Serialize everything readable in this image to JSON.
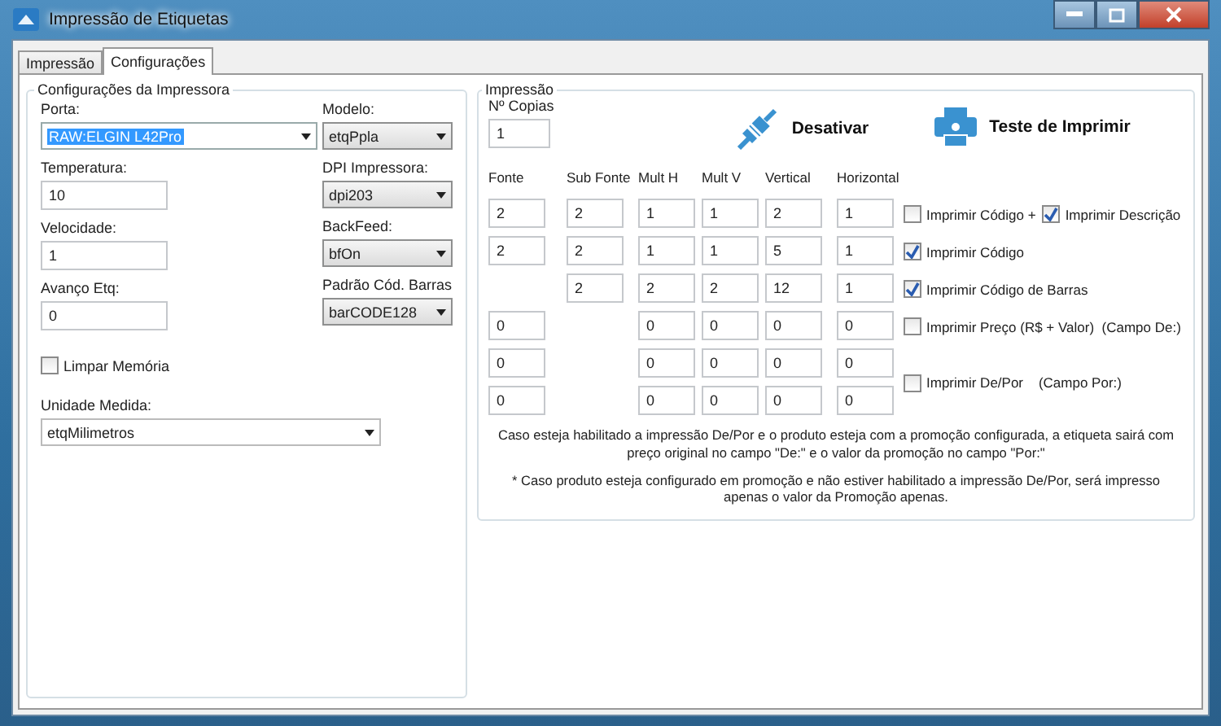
{
  "window": {
    "title": "Impressão de Etiquetas"
  },
  "tabs": [
    {
      "label": "Impressão",
      "selected": false
    },
    {
      "label": "Configurações",
      "selected": true
    }
  ],
  "printer_config": {
    "title": "Configurações da Impressora",
    "left_fields": [
      {
        "label": "Porta:",
        "kind": "combo",
        "value": "RAW:ELGIN L42Pro",
        "focused": true
      },
      {
        "label": "Temperatura:",
        "kind": "text",
        "value": "10"
      },
      {
        "label": "Velocidade:",
        "kind": "text",
        "value": "1"
      },
      {
        "label": "Avanço Etq:",
        "kind": "text",
        "value": "0"
      }
    ],
    "right_fields": [
      {
        "label": "Modelo:",
        "value": "etqPpla"
      },
      {
        "label": "DPI Impressora:",
        "value": "dpi203"
      },
      {
        "label": "BackFeed:",
        "value": "bfOn"
      },
      {
        "label": "Padrão Cód. Barras",
        "value": "barCODE128"
      }
    ],
    "clear_memory": {
      "label": "Limpar Memória",
      "checked": false
    },
    "unit": {
      "label": "Unidade Medida:",
      "value": "etqMilimetros"
    }
  },
  "printing": {
    "title": "Impressão",
    "copies": {
      "label": "Nº Copias",
      "value": "1"
    },
    "buttons": [
      {
        "label": "Desativar",
        "kind": "plug"
      },
      {
        "label": "Teste de Imprimir",
        "kind": "printer"
      }
    ],
    "columns": [
      "Fonte",
      "Sub Fonte",
      "Mult H",
      "Mult V",
      "Vertical",
      "Horizontal"
    ],
    "rows": [
      {
        "cells": [
          "2",
          "2",
          "1",
          "1",
          "2",
          "1"
        ],
        "options": [
          {
            "label": "Imprimir Código +",
            "checked": false
          },
          {
            "label": "Imprimir Descrição",
            "checked": true
          }
        ]
      },
      {
        "cells": [
          "2",
          "2",
          "1",
          "1",
          "5",
          "1"
        ],
        "options": [
          {
            "label": "Imprimir Código",
            "checked": true
          }
        ]
      },
      {
        "cells": [
          null,
          "2",
          "2",
          "2",
          "12",
          "1"
        ],
        "options": [
          {
            "label": "Imprimir Código de Barras",
            "checked": true
          }
        ]
      },
      {
        "cells": [
          "0",
          null,
          "0",
          "0",
          "0",
          "0"
        ],
        "options": [
          {
            "label": "Imprimir Preço (R$ + Valor)  (Campo De:)",
            "checked": false
          }
        ]
      },
      {
        "cells": [
          "0",
          null,
          "0",
          "0",
          "0",
          "0"
        ],
        "options": [
          {
            "label": "Imprimir De/Por    (Campo Por:)",
            "checked": false
          }
        ]
      },
      {
        "cells": [
          "0",
          null,
          "0",
          "0",
          "0",
          "0"
        ],
        "options": []
      }
    ],
    "notes": [
      "Caso esteja habilitado a impressão De/Por e o produto esteja com a promoção configurada, a etiqueta sairá com preço original no campo \"De:\" e o valor da promoção no campo \"Por:\"",
      "* Caso produto esteja configurado em promoção e não estiver habilitado a impressão De/Por, será impresso apenas o valor da Promoção apenas."
    ]
  }
}
